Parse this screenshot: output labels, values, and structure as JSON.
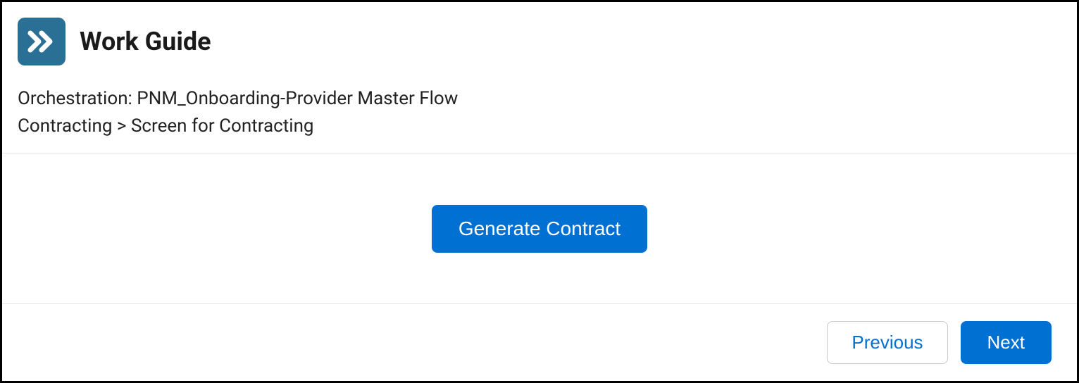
{
  "header": {
    "title": "Work Guide",
    "orchestration_line": "Orchestration: PNM_Onboarding-Provider Master Flow",
    "breadcrumb": "Contracting > Screen for Contracting"
  },
  "body": {
    "primary_action": "Generate Contract"
  },
  "footer": {
    "previous_label": "Previous",
    "next_label": "Next"
  }
}
